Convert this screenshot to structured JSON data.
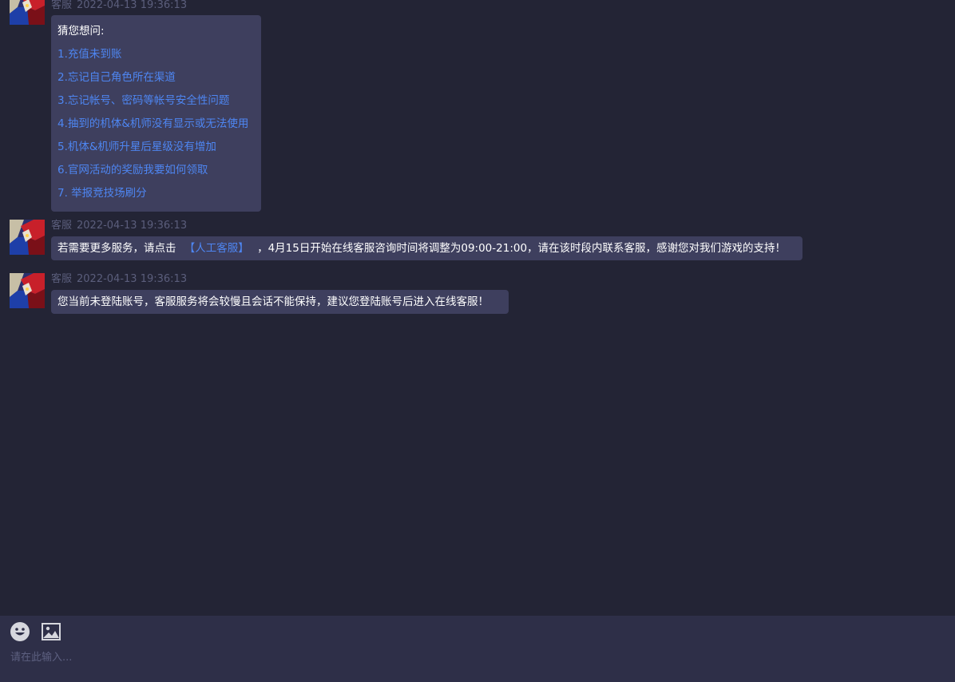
{
  "messages": [
    {
      "sender": "客服",
      "time": "2022-04-13 19:36:13",
      "menu_title": "猜您想问:",
      "menu_items": [
        "1.充值未到账",
        "2.忘记自己角色所在渠道",
        "3.忘记帐号、密码等帐号安全性问题",
        "4.抽到的机体&机师没有显示或无法使用",
        "5.机体&机师升星后星级没有增加",
        "6.官网活动的奖励我要如何领取",
        "7. 举报竞技场刷分"
      ]
    },
    {
      "sender": "客服",
      "time": "2022-04-13 19:36:13",
      "text_before": "若需要更多服务，请点击",
      "link_text": "【人工客服】",
      "text_after": "，4月15日开始在线客服咨询时间将调整为09:00-21:00，请在该时段内联系客服，感谢您对我们游戏的支持！"
    },
    {
      "sender": "客服",
      "time": "2022-04-13 19:36:13",
      "text": "您当前未登陆账号，客服服务将会较慢且会话不能保持，建议您登陆账号后进入在线客服！"
    }
  ],
  "composer": {
    "placeholder": "请在此输入...",
    "tools": [
      "emoji-icon",
      "image-icon"
    ]
  },
  "colors": {
    "background": "#232435",
    "bubble": "#3e3f5e",
    "link": "#4e86f2",
    "composer": "#2e2f48",
    "meta": "#5b5e7c"
  }
}
